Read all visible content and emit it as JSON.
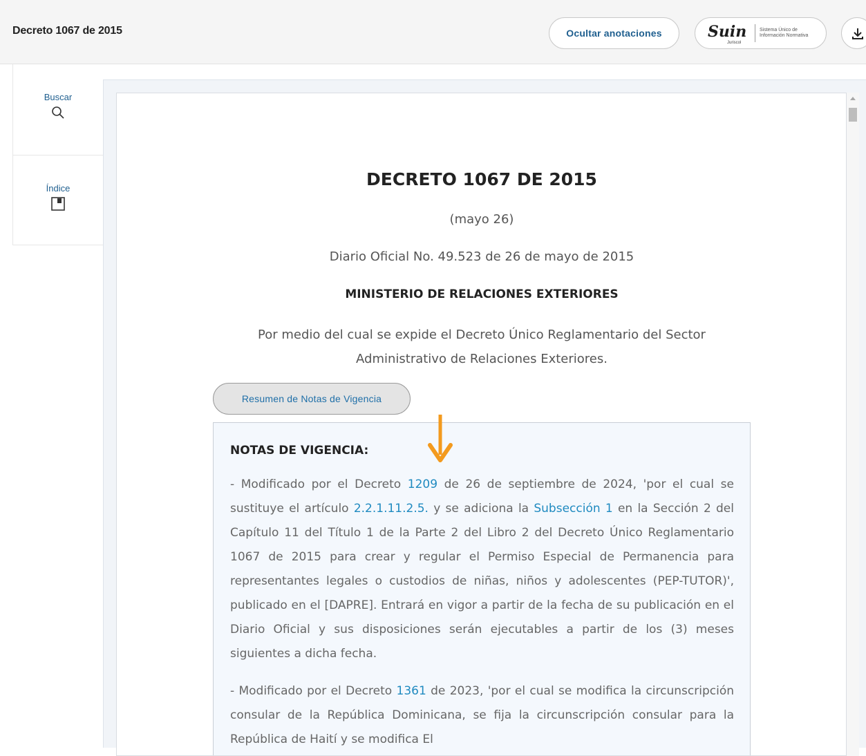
{
  "header": {
    "title": "Decreto 1067 de 2015",
    "annotations_button": "Ocultar anotaciones",
    "suin_logo_text": "Suin",
    "suin_logo_subtext": "Juriscol",
    "suin_caption_line1": "Sistema Único de",
    "suin_caption_line2": "Información Normativa",
    "download_icon": "download-icon"
  },
  "sidebar": {
    "items": [
      {
        "label": "Buscar",
        "icon": "search-icon"
      },
      {
        "label": "Índice",
        "icon": "bookmark-icon"
      }
    ]
  },
  "document": {
    "title": "DECRETO 1067 DE 2015",
    "date": "(mayo 26)",
    "gazette": "Diario Oficial No. 49.523 de 26 de mayo de 2015",
    "ministry": "MINISTERIO DE RELACIONES EXTERIORES",
    "description_line1": "Por medio del cual se expide el Decreto Único Reglamentario del Sector",
    "description_line2": "Administrativo de Relaciones Exteriores.",
    "summary_button": "Resumen de Notas de Vigencia",
    "notes_title": "NOTAS DE VIGENCIA:",
    "note1": {
      "prefix": "- Modificado por el Decreto ",
      "decree_link": "1209",
      "part2": " de 26 de septiembre de 2024, 'por el cual se sustituye el artículo ",
      "article_link": "2.2.1.11.2.5.",
      "part3": " y se adiciona la ",
      "subsection_link": "Subsección 1",
      "part4": " en la Sección 2 del Capítulo 11 del Título 1 de la Parte 2 del Libro 2 del Decreto Único Reglamentario 1067 de 2015 para crear y regular el Permiso Especial de Permanencia para representantes legales o custodios de niñas, niños y adolescentes (PEP-TUTOR)', publicado en el [DAPRE]. Entrará en vigor a partir de la fecha de su publicación en el Diario Oficial y sus disposiciones serán ejecutables a partir de los (3) meses siguientes a dicha fecha."
    },
    "note2": {
      "prefix": "- Modificado por el Decreto ",
      "decree_link": "1361",
      "part2": " de 2023, 'por el cual se modifica la circunscripción consular de la República Dominicana, se fija la circunscripción consular para la República de Haití y se modifica El"
    }
  },
  "colors": {
    "accent_link": "#1f8ac0",
    "button_text": "#1f5f8f",
    "annotation_arrow": "#f39a1e",
    "notes_background": "#f4f8fd"
  }
}
